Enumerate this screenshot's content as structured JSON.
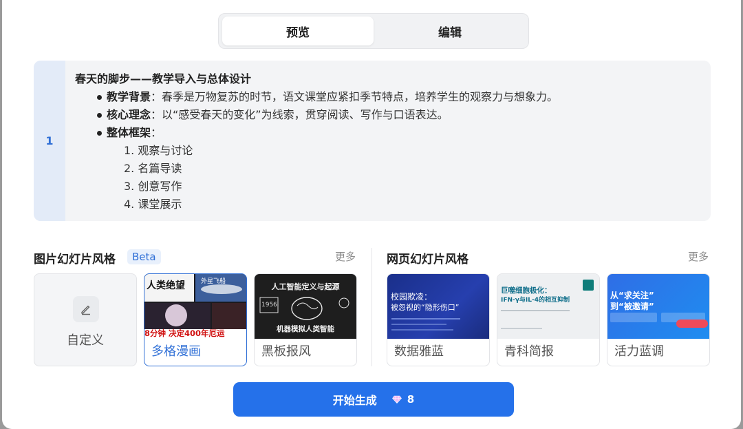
{
  "tabs": {
    "preview": "预览",
    "edit": "编辑"
  },
  "outline": {
    "index": "1",
    "title": "春天的脚步——教学导入与总体设计",
    "bullets": [
      {
        "label": "教学背景",
        "text": "：春季是万物复苏的时节，语文课堂应紧扣季节特点，培养学生的观察力与想象力。"
      },
      {
        "label": "核心理念",
        "text": "：以“感受春天的变化”为线索，贯穿阅读、写作与口语表达。"
      },
      {
        "label": "整体框架",
        "text": "："
      }
    ],
    "framework": [
      "1. 观察与讨论",
      "2. 名篇导读",
      "3. 创意写作",
      "4. 课堂展示"
    ]
  },
  "image_styles": {
    "title": "图片幻灯片风格",
    "badge": "Beta",
    "more": "更多",
    "custom_label": "自定义",
    "items": [
      {
        "label": "多格漫画",
        "thumb_text": [
          "人类绝望",
          "外星飞船",
          "8分钟 决定400年厄运"
        ]
      },
      {
        "label": "黑板报风",
        "thumb_text": [
          "人工智能定义与起源",
          "1956",
          "机器模拟人类智能"
        ]
      }
    ]
  },
  "web_styles": {
    "title": "网页幻灯片风格",
    "more": "更多",
    "items": [
      {
        "label": "数据雅蓝",
        "thumb_text": [
          "校园欺凌：",
          "被忽视的“隐形伤口”"
        ]
      },
      {
        "label": "青科简报",
        "thumb_text": [
          "巨噬细胞极化：",
          "IFN-γ与IL-4的相互抑制"
        ]
      },
      {
        "label": "活力蓝调",
        "thumb_text": [
          "从“求关注”",
          "到“被邀请”"
        ]
      }
    ]
  },
  "generate": {
    "label": "开始生成",
    "cost": "8"
  }
}
